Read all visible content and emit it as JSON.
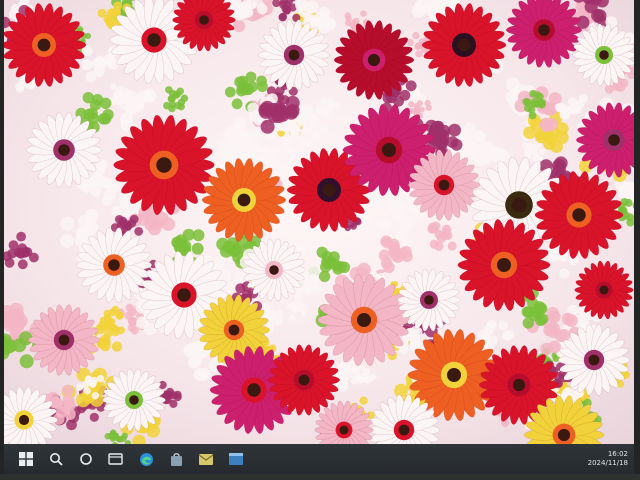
{
  "desktop": {
    "wallpaper": "flower-bouquet-photo",
    "palette": {
      "red": "#d8132a",
      "crimson": "#b50d2b",
      "magenta": "#cc1f6e",
      "pink": "#f3b6c6",
      "white": "#fbf5f5",
      "orange": "#ee5f22",
      "yellow": "#f2d23a",
      "green": "#7bbf3a",
      "purple": "#a0306a"
    }
  },
  "taskbar": {
    "background": "#2b3034",
    "items": [
      {
        "name": "start-button",
        "icon": "windows-logo-icon"
      },
      {
        "name": "search-button",
        "icon": "search-icon"
      },
      {
        "name": "task-view-button",
        "icon": "task-view-icon"
      },
      {
        "name": "file-explorer-button",
        "icon": "file-explorer-icon"
      },
      {
        "name": "edge-button",
        "icon": "edge-browser-icon"
      },
      {
        "name": "store-button",
        "icon": "store-bag-icon"
      },
      {
        "name": "mail-button",
        "icon": "mail-icon"
      },
      {
        "name": "app-button",
        "icon": "app-window-icon"
      }
    ],
    "clock": {
      "time": "16:02",
      "date": "2024/11/18"
    }
  }
}
